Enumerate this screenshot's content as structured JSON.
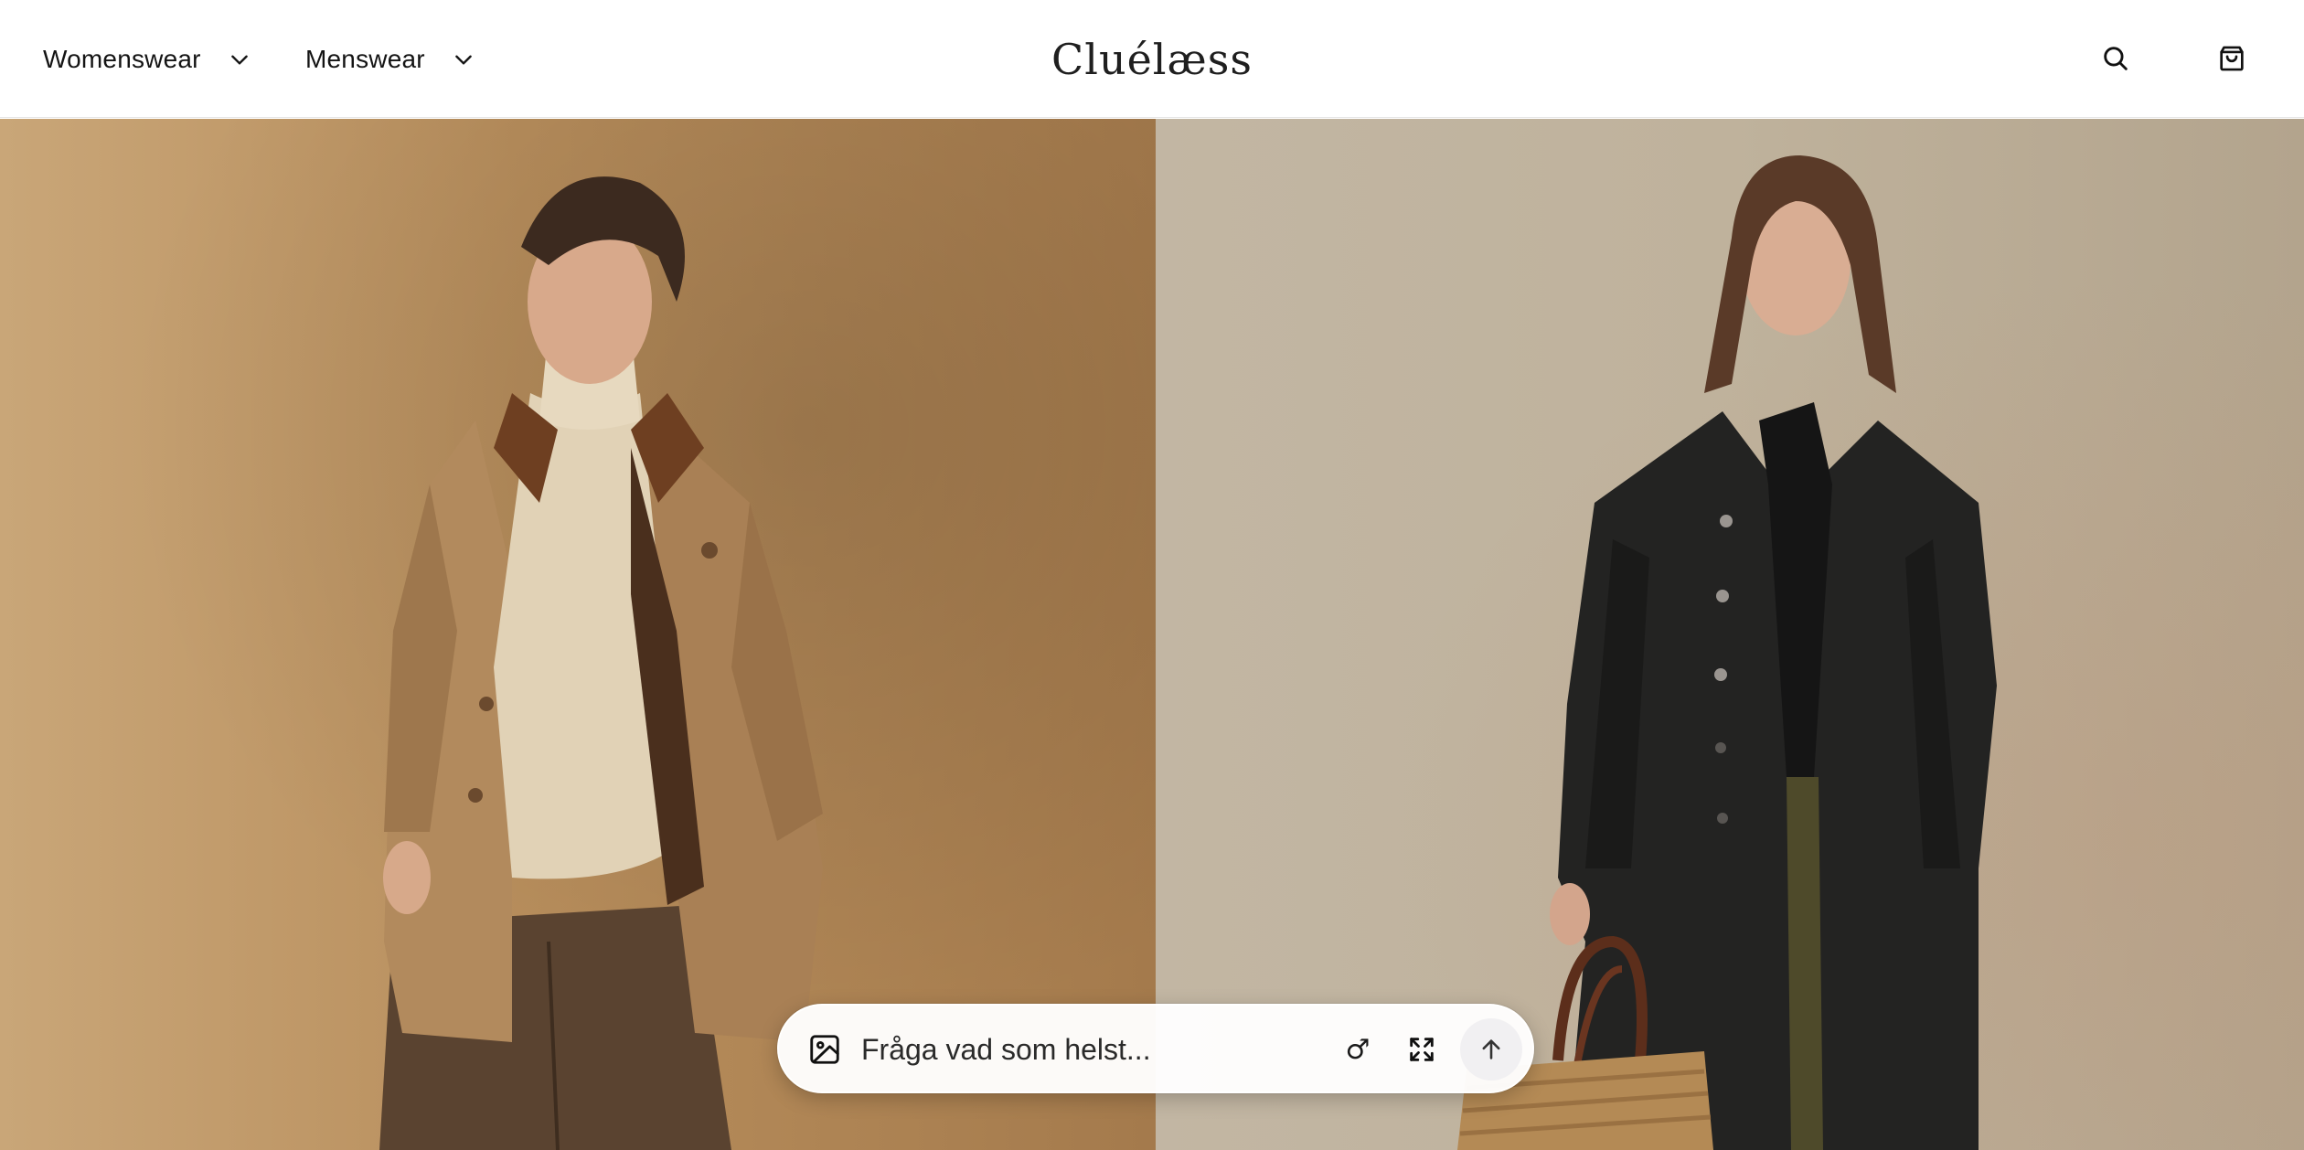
{
  "header": {
    "brand": "Cluélæss",
    "nav": [
      {
        "label": "Womenswear",
        "icon": "chevron-down-icon"
      },
      {
        "label": "Menswear",
        "icon": "chevron-down-icon"
      }
    ],
    "icons": {
      "search": "search-icon",
      "cart": "shopping-bag-icon"
    }
  },
  "hero": {
    "left_background": "#b88e5c",
    "right_background": "#bfb29c"
  },
  "chat": {
    "placeholder": "Fråga vad som helst...",
    "gender_symbol": "♂",
    "icons": {
      "image": "image-upload-icon",
      "gender": "male-symbol-icon",
      "expand": "expand-icon",
      "send": "arrow-up-icon"
    }
  }
}
